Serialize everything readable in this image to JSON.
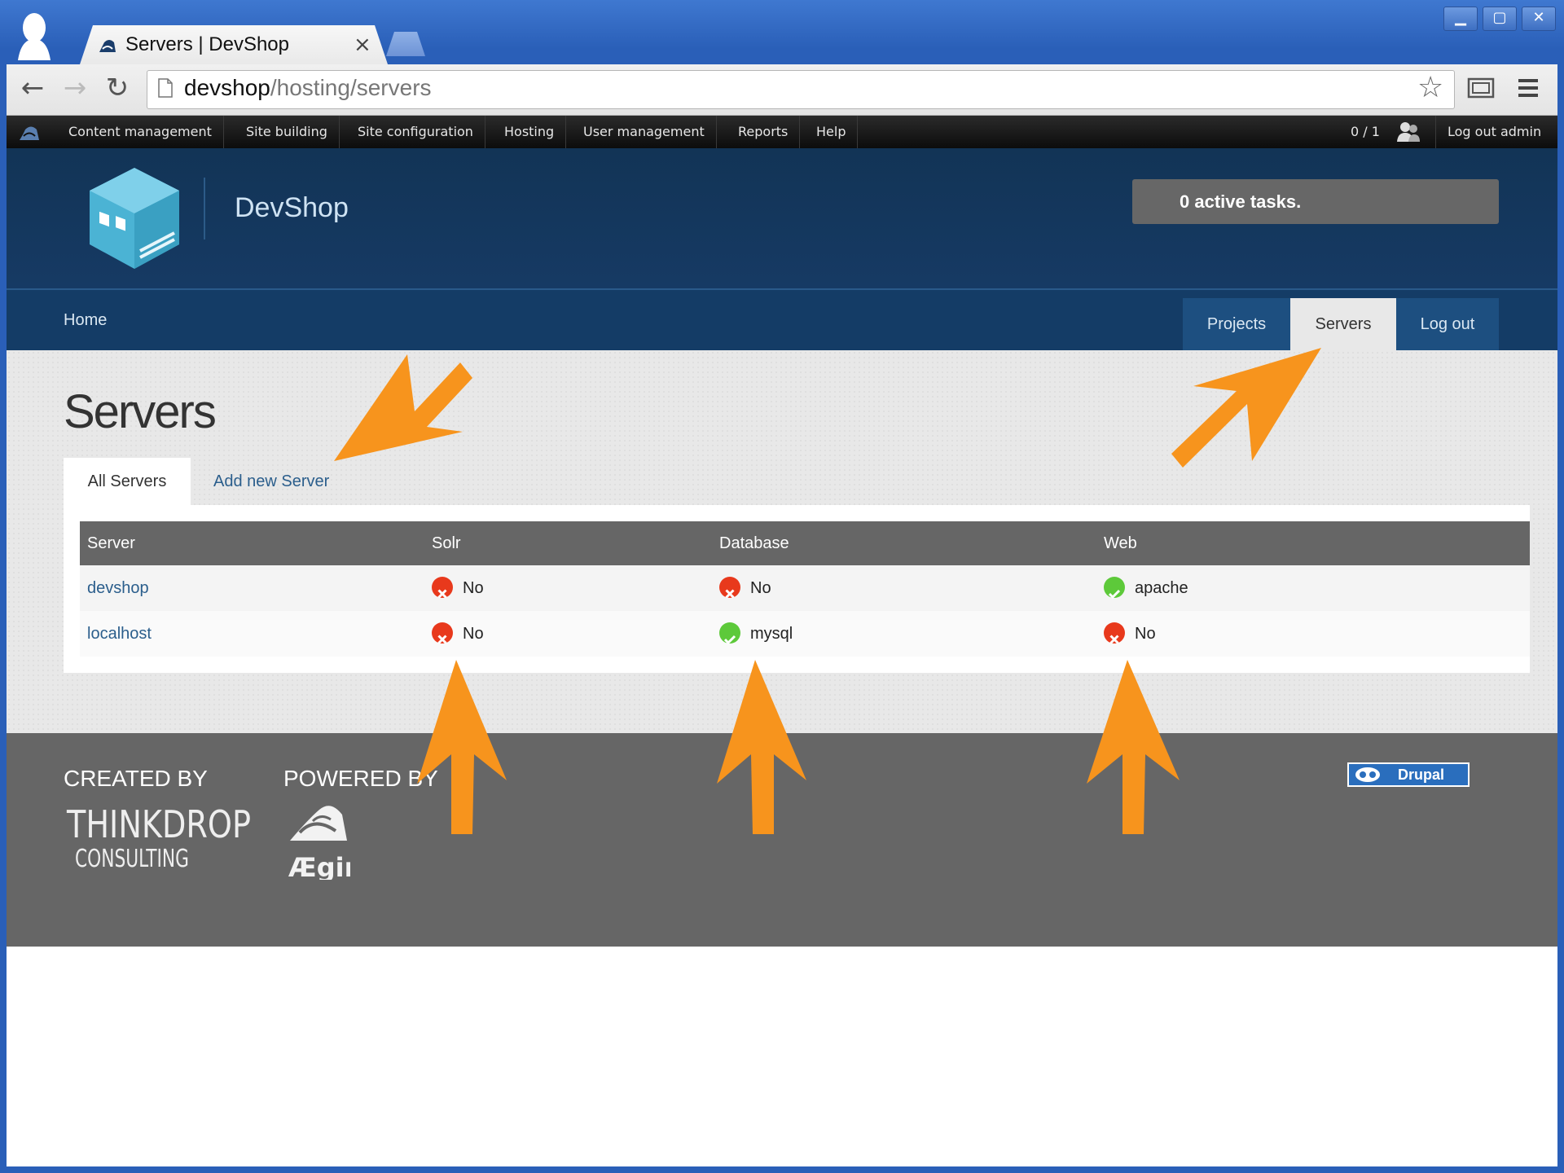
{
  "browser": {
    "tab_title": "Servers | DevShop",
    "tab_close": "×",
    "url_host": "devshop",
    "url_path": "/hosting/servers",
    "window_controls": [
      "minimize-icon",
      "maximize-icon",
      "close-icon"
    ]
  },
  "admin_menu": {
    "items": [
      "Content management",
      "Site building",
      "Site configuration",
      "Hosting",
      "User management",
      "Reports",
      "Help"
    ],
    "users_count": "0 / 1",
    "logout": "Log out admin"
  },
  "header": {
    "site_name": "DevShop",
    "tasks": "0 active tasks."
  },
  "nav": {
    "home": "Home",
    "tabs": [
      {
        "label": "Projects",
        "active": false
      },
      {
        "label": "Servers",
        "active": true
      },
      {
        "label": "Log out",
        "active": false
      }
    ]
  },
  "page": {
    "title": "Servers",
    "tabs": [
      {
        "label": "All Servers",
        "active": true
      },
      {
        "label": "Add new Server",
        "active": false
      }
    ]
  },
  "table": {
    "headers": [
      "Server",
      "Solr",
      "Database",
      "Web"
    ],
    "rows": [
      {
        "server": "devshop",
        "solr": {
          "ok": false,
          "text": "No"
        },
        "database": {
          "ok": false,
          "text": "No"
        },
        "web": {
          "ok": true,
          "text": "apache"
        }
      },
      {
        "server": "localhost",
        "solr": {
          "ok": false,
          "text": "No"
        },
        "database": {
          "ok": true,
          "text": "mysql"
        },
        "web": {
          "ok": false,
          "text": "No"
        }
      }
    ]
  },
  "footer": {
    "created_by": "CREATED BY",
    "powered_by": "POWERED BY",
    "thinkdrop_line1": "THINKDROP",
    "thinkdrop_line2": "CONSULTING",
    "aegir": "Ægir",
    "drupal": "Drupal"
  },
  "colors": {
    "annotation_arrow": "#f7941d",
    "status_no": "#e8391c",
    "status_yes": "#5dc93a"
  }
}
